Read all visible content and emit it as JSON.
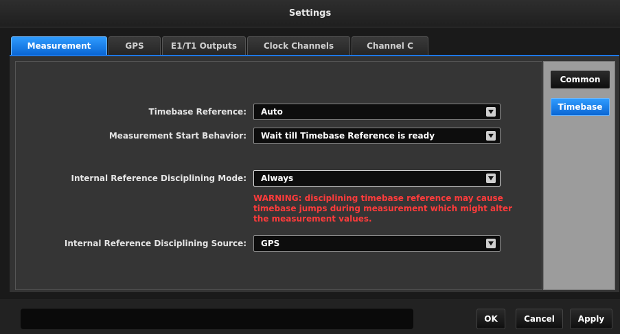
{
  "window": {
    "title": "Settings"
  },
  "tabs": [
    {
      "label": "Measurement",
      "active": true
    },
    {
      "label": "GPS",
      "active": false
    },
    {
      "label": "E1/T1 Outputs",
      "active": false
    },
    {
      "label": "Clock Channels",
      "active": false
    },
    {
      "label": "Channel C",
      "active": false
    }
  ],
  "side": {
    "common": "Common",
    "timebase": "Timebase"
  },
  "fields": {
    "timebase_reference": {
      "label": "Timebase Reference:",
      "value": "Auto"
    },
    "start_behavior": {
      "label": "Measurement Start Behavior:",
      "value": "Wait till Timebase Reference is ready"
    },
    "disciplining_mode": {
      "label": "Internal Reference Disciplining Mode:",
      "value": "Always"
    },
    "disciplining_source": {
      "label": "Internal Reference Disciplining Source:",
      "value": "GPS"
    }
  },
  "warning": "WARNING: disciplining timebase reference may cause timebase jumps during measurement which might alter the measurement values.",
  "footer": {
    "status": "",
    "ok": "OK",
    "cancel": "Cancel",
    "apply": "Apply"
  },
  "colors": {
    "accent": "#1e78e6",
    "warning": "#ff3b3b"
  }
}
